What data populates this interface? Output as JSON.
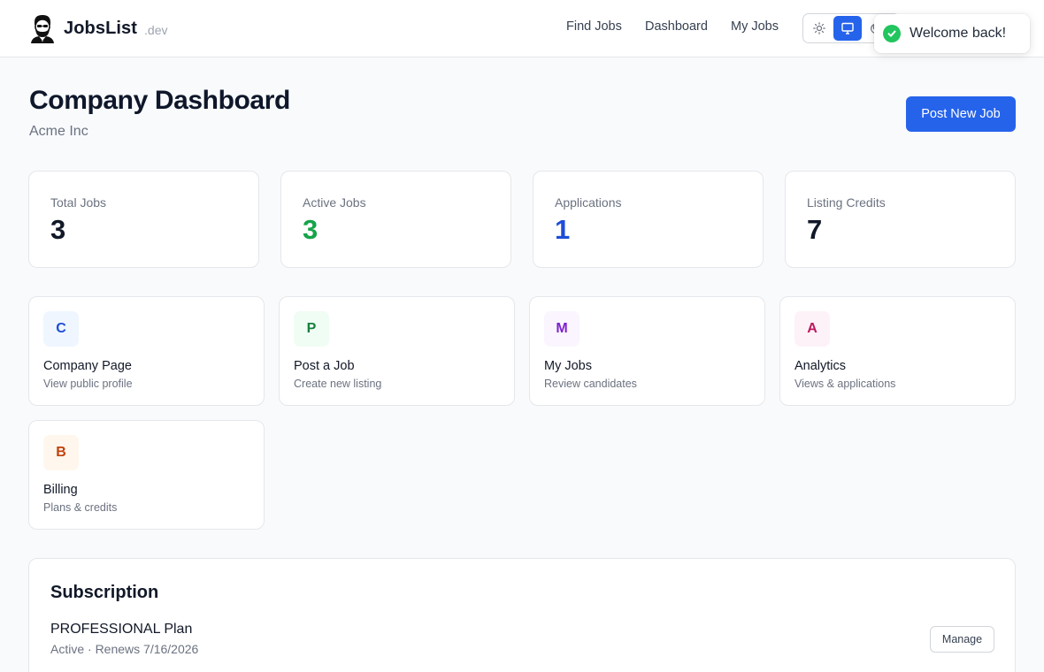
{
  "header": {
    "brand_name": "JobsList",
    "brand_tld": ".dev",
    "nav": {
      "find_jobs": "Find Jobs",
      "dashboard": "Dashboard",
      "my_jobs": "My Jobs"
    },
    "theme_options": [
      "light",
      "system",
      "dark"
    ],
    "theme_selected": "system"
  },
  "toast": {
    "message": "Welcome back!"
  },
  "page": {
    "title": "Company Dashboard",
    "company": "Acme Inc",
    "post_button": "Post New Job"
  },
  "stats": [
    {
      "label": "Total Jobs",
      "value": "3",
      "color": "#111827"
    },
    {
      "label": "Active Jobs",
      "value": "3",
      "color": "#16a34a"
    },
    {
      "label": "Applications",
      "value": "1",
      "color": "#1d4ed8"
    },
    {
      "label": "Listing Credits",
      "value": "7",
      "color": "#111827"
    }
  ],
  "actions": [
    {
      "letter": "C",
      "title": "Company Page",
      "desc": "View public profile",
      "bg": "#eff6ff",
      "fg": "#1d4ed8"
    },
    {
      "letter": "P",
      "title": "Post a Job",
      "desc": "Create new listing",
      "bg": "#f0fdf4",
      "fg": "#15803d"
    },
    {
      "letter": "M",
      "title": "My Jobs",
      "desc": "Review candidates",
      "bg": "#faf5ff",
      "fg": "#7e22ce"
    },
    {
      "letter": "A",
      "title": "Analytics",
      "desc": "Views & applications",
      "bg": "#fdf2f8",
      "fg": "#be185d"
    },
    {
      "letter": "B",
      "title": "Billing",
      "desc": "Plans & credits",
      "bg": "#fff7ed",
      "fg": "#c2410c"
    }
  ],
  "subscription": {
    "heading": "Subscription",
    "plan": "PROFESSIONAL Plan",
    "status": "Active · Renews 7/16/2026",
    "manage_button": "Manage"
  },
  "colors": {
    "accent": "#2563eb",
    "success": "#22c55e"
  }
}
